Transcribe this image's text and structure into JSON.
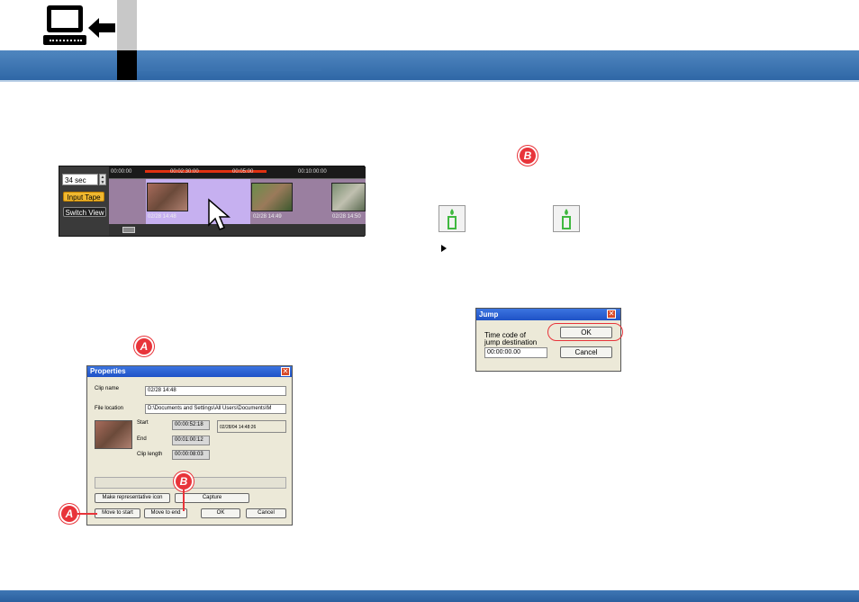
{
  "timeline": {
    "duration_value": "34 sec",
    "input_tape_label": "Input Tape",
    "switch_view_label": "Switch View",
    "ruler_ticks": [
      "00:00:00",
      "00:02:30:00",
      "00:05:00",
      "00:10:00:00"
    ],
    "clips": [
      {
        "label": "02/28 14:48"
      },
      {
        "label": "02/28 14:49"
      },
      {
        "label": "02/28 14:50"
      }
    ]
  },
  "markers": {
    "a": "A",
    "b": "B"
  },
  "properties_dialog": {
    "title": "Properties",
    "clip_name_label": "Clip name",
    "clip_name_value": "02/28 14:48",
    "file_location_label": "File location",
    "file_location_value": "D:\\Documents and Settings\\All Users\\Documents\\M",
    "start_label": "Start",
    "start_value": "00:00:52:18",
    "recorded_value": "02/28/04 14:48:26",
    "end_label": "End",
    "end_value": "00:01:00:12",
    "clip_length_label": "Clip length",
    "clip_length_value": "00:00:08:03",
    "make_icon_button": "Make representative icon",
    "capture_button": "Capture",
    "move_start_button": "Move to start",
    "move_end_button": "Move to end",
    "ok_button": "OK",
    "cancel_button": "Cancel"
  },
  "jump_dialog": {
    "title": "Jump",
    "label_line1": "Time code of",
    "label_line2": "jump destination",
    "timecode_value": "00:00:00.00",
    "ok_button": "OK",
    "cancel_button": "Cancel"
  },
  "colors": {
    "header": "#3a70ad",
    "marker": "#e8343a",
    "accent_orange": "#f0b830"
  },
  "icons": [
    "computer-monitor-icon",
    "left-arrow-icon",
    "candle-icon",
    "play-icon",
    "close-icon",
    "pointer-cursor-icon"
  ]
}
